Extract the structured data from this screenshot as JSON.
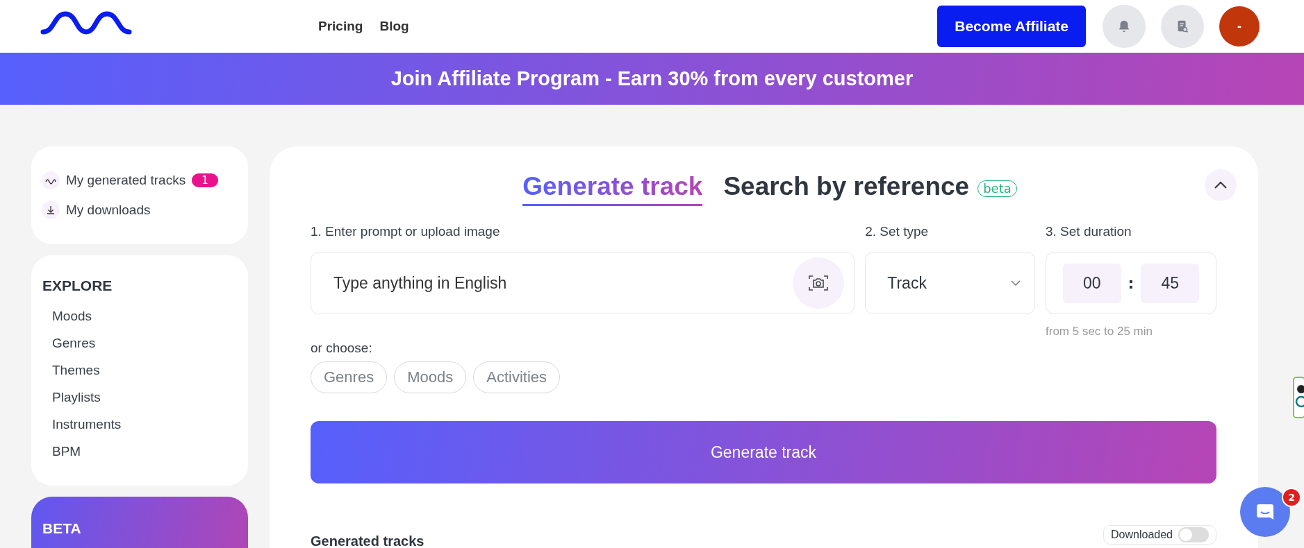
{
  "nav": {
    "links": [
      "Pricing",
      "Blog"
    ],
    "affiliate_button": "Become Affiliate",
    "avatar_initial": "-"
  },
  "banner": "Join Affiliate Program - Earn 30% from every customer",
  "sidebar": {
    "my_items": [
      {
        "kind": "wave",
        "label": "My generated tracks",
        "badge": "1"
      },
      {
        "kind": "download",
        "label": "My downloads"
      }
    ],
    "explore_title": "EXPLORE",
    "explore_items": [
      "Moods",
      "Genres",
      "Themes",
      "Playlists",
      "Instruments",
      "BPM"
    ],
    "beta_card_title": "BETA"
  },
  "tabs": [
    {
      "label": "Generate track",
      "selected": true
    },
    {
      "label": "Search by reference",
      "selected": false,
      "badge": "beta"
    }
  ],
  "form": {
    "prompt_label": "1. Enter prompt or upload image",
    "prompt_placeholder": "Type anything in English",
    "type_label": "2. Set type",
    "type_value": "Track",
    "duration_label": "3. Set duration",
    "minutes": "00",
    "separator": ":",
    "seconds": "45",
    "duration_hint": "from 5 sec to 25 min",
    "choose_label": "or choose:",
    "chips": [
      "Genres",
      "Moods",
      "Activities"
    ],
    "generate_button": "Generate track"
  },
  "generated": {
    "title": "Generated tracks",
    "toggle_label": "Downloaded",
    "toggle_on": false
  },
  "chat": {
    "badge": "2"
  }
}
